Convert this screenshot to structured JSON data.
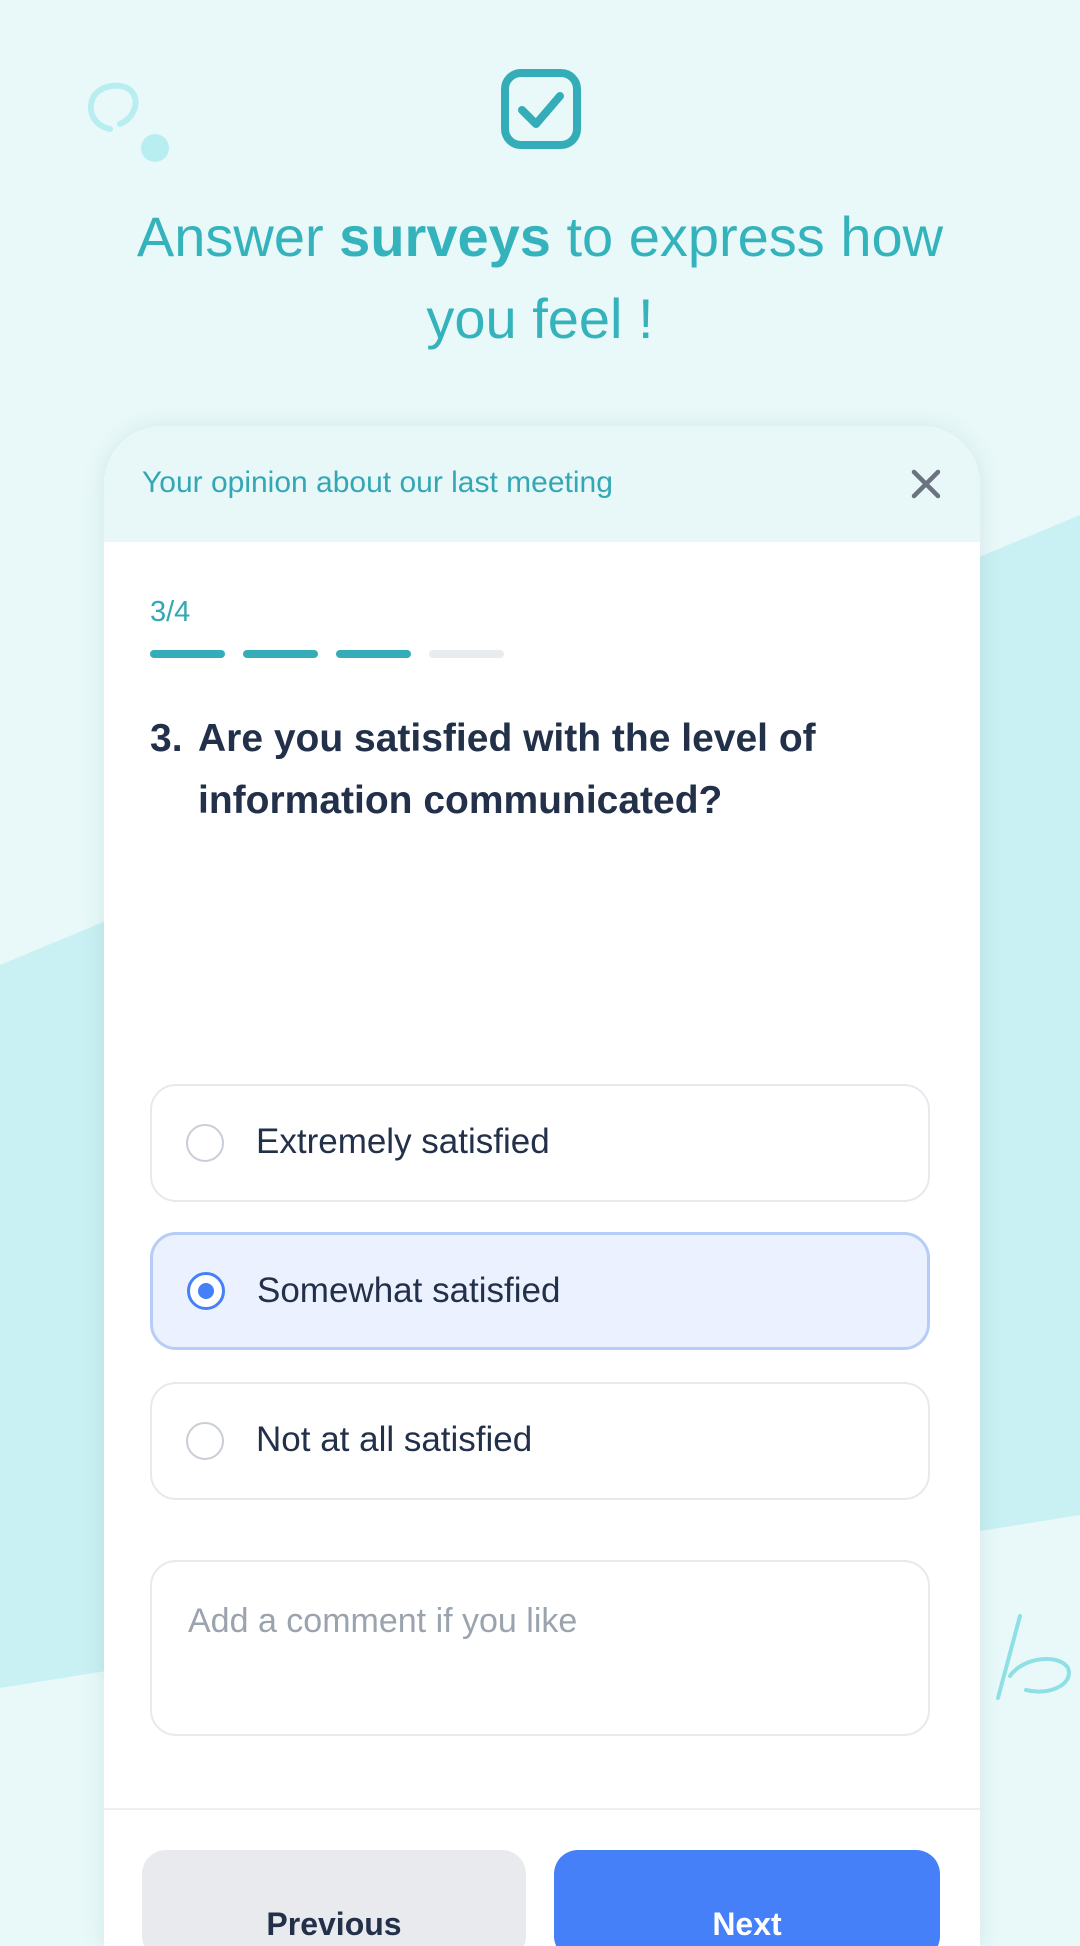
{
  "colors": {
    "accent_teal": "#34b3bd",
    "background": "#e9f9f9",
    "background_shape": "#c9f1f3",
    "primary_blue": "#4580f8",
    "selected_bg": "#ebf1ff",
    "text_dark": "#22304a"
  },
  "hero": {
    "icon": "checkbox-checked-icon",
    "headline_before": "Answer ",
    "headline_bold": "surveys",
    "headline_after": " to express how you feel !"
  },
  "survey": {
    "title": "Your opinion about our last meeting",
    "close_icon": "close-icon",
    "step_label": "3/4",
    "progress": {
      "current": 3,
      "total": 4
    },
    "question_number": "3.",
    "question_text": "Are you satisfied with the level of information communicated?",
    "options": [
      {
        "label": "Extremely satisfied",
        "selected": false
      },
      {
        "label": "Somewhat satisfied",
        "selected": true
      },
      {
        "label": "Not at all satisfied",
        "selected": false
      }
    ],
    "comment": {
      "placeholder": "Add a comment if you like",
      "value": ""
    },
    "buttons": {
      "previous": "Previous",
      "next": "Next"
    }
  }
}
